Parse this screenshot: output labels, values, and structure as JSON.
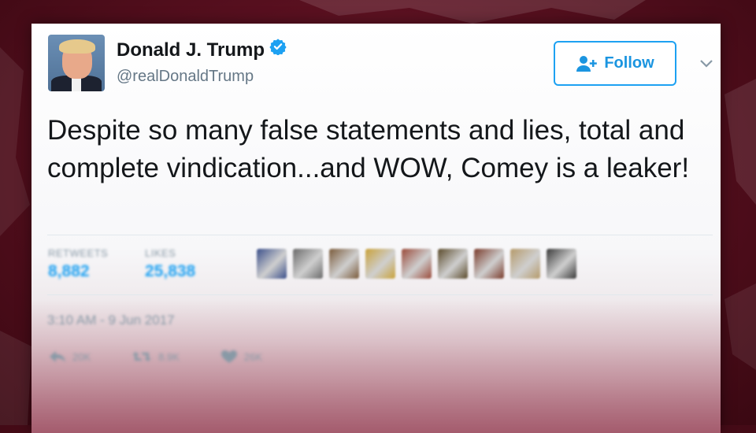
{
  "tweet": {
    "author_name": "Donald J. Trump",
    "author_handle": "@realDonaldTrump",
    "follow_label": "Follow",
    "text": "Despite so many false statements and lies, total and complete vindication...and WOW, Comey is a leaker!",
    "stats": {
      "retweets_label": "RETWEETS",
      "retweets_value": "8,882",
      "likes_label": "LIKES",
      "likes_value": "25,838"
    },
    "timestamp": "3:10 AM - 9 Jun 2017",
    "actions": {
      "reply_count": "20K",
      "retweet_count": "8.9K",
      "like_count": "26K"
    }
  },
  "colors": {
    "accent": "#1da1f2",
    "background": "#6a1a2b",
    "text": "#14171a",
    "muted": "#657786"
  },
  "icons": [
    "verified-badge-icon",
    "add-user-icon",
    "chevron-down-icon",
    "reply-icon",
    "retweet-icon",
    "heart-icon"
  ],
  "liker_avatars": [
    "#3b4f8a",
    "#6a6a6a",
    "#7a5a3a",
    "#c9a23a",
    "#9a4a3a",
    "#5a4a2a",
    "#7a3a2a",
    "#b59a6a",
    "#3a3a3a"
  ]
}
